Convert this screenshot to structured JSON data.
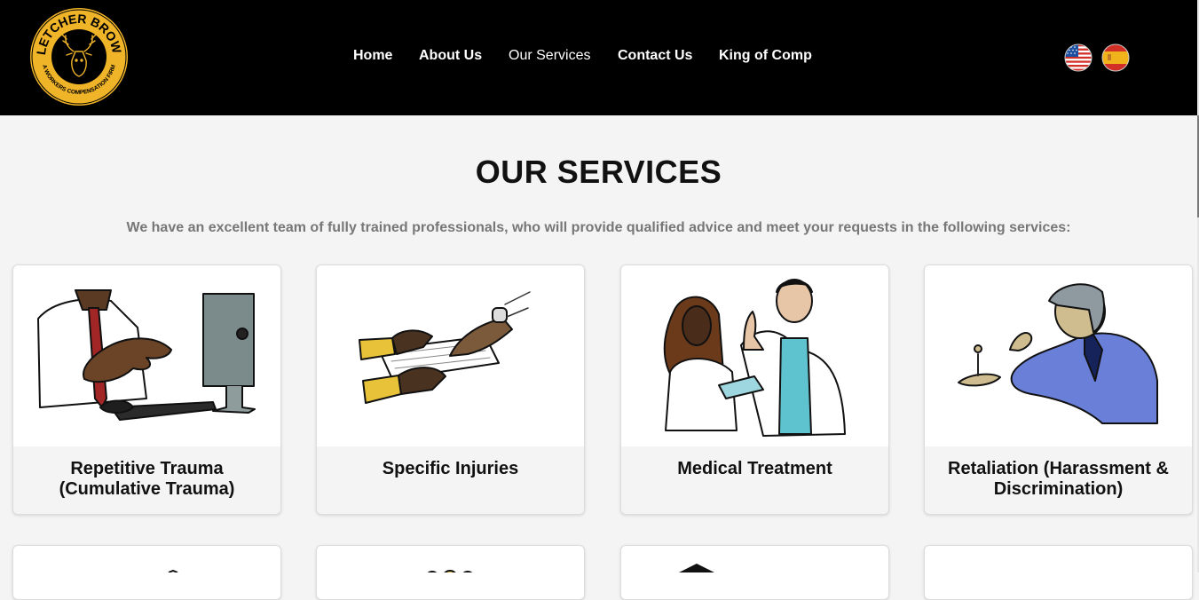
{
  "header": {
    "logo": {
      "top_text": "FLETCHER BROWN",
      "bottom_text": "A WORKERS COMPENSATION FIRM",
      "icon": "stag-head-icon"
    },
    "nav": [
      {
        "label": "Home"
      },
      {
        "label": "About Us"
      },
      {
        "label": "Our Services",
        "active": true
      },
      {
        "label": "Contact Us"
      },
      {
        "label": "King of Comp"
      }
    ],
    "languages": [
      {
        "icon": "us-flag-icon"
      },
      {
        "icon": "spain-flag-icon"
      }
    ]
  },
  "main": {
    "heading": "OUR SERVICES",
    "intro": "We have an excellent team of fully trained professionals, who will provide qualified advice and meet your requests in the following services:",
    "services": [
      {
        "title": "Repetitive Trauma (Cumulative Trauma)",
        "icon": "repetitive-trauma-illustration"
      },
      {
        "title": "Specific Injuries",
        "icon": "specific-injuries-illustration"
      },
      {
        "title": "Medical Treatment",
        "icon": "medical-treatment-illustration"
      },
      {
        "title": "Retaliation (Harassment & Discrimination)",
        "icon": "retaliation-illustration"
      }
    ]
  },
  "colors": {
    "header_bg": "#000000",
    "logo_gold": "#f0b429",
    "page_bg": "#f4f4f4"
  }
}
